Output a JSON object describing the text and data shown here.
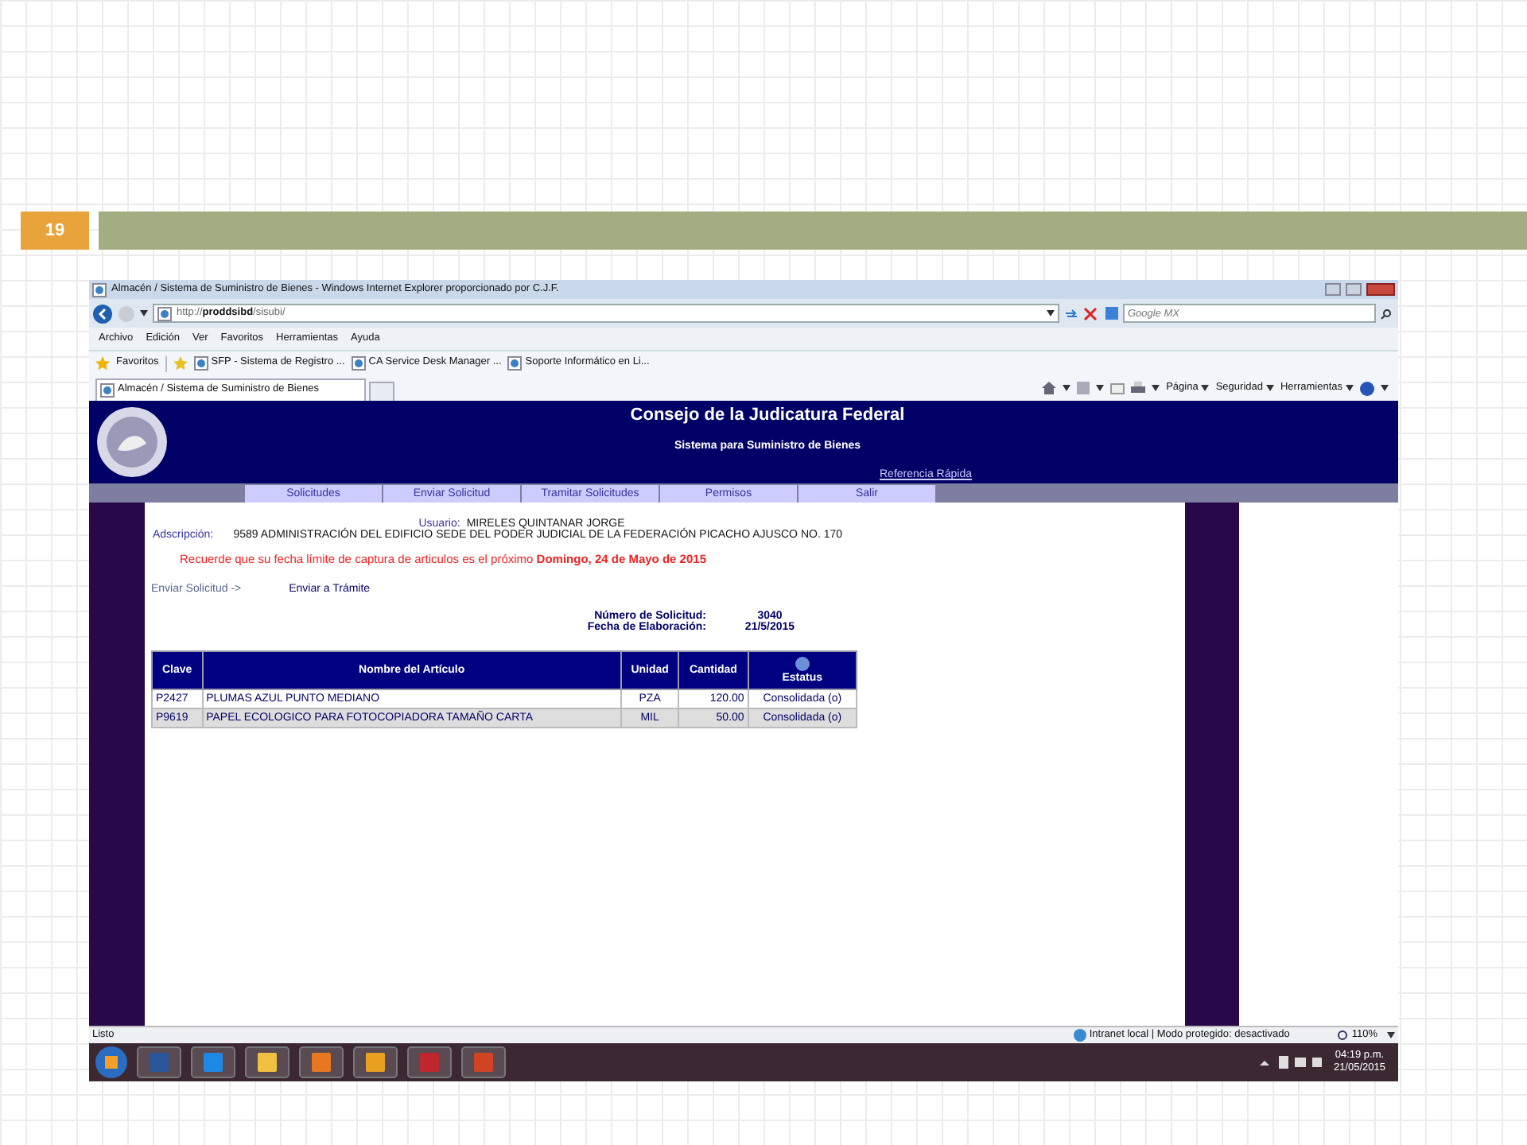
{
  "slide": {
    "number": "19"
  },
  "window": {
    "title": "Almacén / Sistema de Suministro de Bienes - Windows Internet Explorer proporcionado por C.J.F.",
    "url_prefix": "http://",
    "url_host": "proddsibd",
    "url_path": "/sisubi/",
    "search_placeholder": "Google MX"
  },
  "menu": [
    "Archivo",
    "Edición",
    "Ver",
    "Favoritos",
    "Herramientas",
    "Ayuda"
  ],
  "favorites": {
    "label": "Favoritos",
    "links": [
      "SFP - Sistema de Registro ...",
      "CA Service Desk Manager ...",
      "Soporte Informático en Li..."
    ]
  },
  "tab": {
    "title": "Almacén / Sistema de Suministro de Bienes"
  },
  "command_bar": [
    "Página",
    "Seguridad",
    "Herramientas"
  ],
  "header": {
    "title": "Consejo de la Judicatura Federal",
    "subtitle": "Sistema para Suministro de Bienes",
    "link": "Referencia Rápida"
  },
  "nav": [
    "Solicitudes",
    "Enviar Solicitud",
    "Tramitar Solicitudes",
    "Permisos",
    "Salir"
  ],
  "user": {
    "label": "Usuario:",
    "value": "MIRELES QUINTANAR JORGE"
  },
  "adscripcion": {
    "label": "Adscripción:",
    "value": "9589 ADMINISTRACIÓN DEL EDIFICIO SEDE DEL PODER JUDICIAL DE LA FEDERACIÓN PICACHO AJUSCO NO. 170"
  },
  "reminder": "Recuerde que su fecha límite de captura de articulos es el próximo **Domingo, 24 de Mayo de 2015**",
  "actions": [
    {
      "label": "Enviar Solicitud ->",
      "kind": "muted"
    },
    {
      "label": "Enviar a Trámite",
      "kind": "primary"
    }
  ],
  "request_info": [
    {
      "label": "Número de Solicitud:",
      "value": "3040"
    },
    {
      "label": "Fecha de Elaboración:",
      "value": "21/5/2015"
    }
  ],
  "table": {
    "columns": [
      "Clave",
      "Nombre del Artículo",
      "Unidad",
      "Cantidad",
      "Estatus"
    ],
    "rows": [
      [
        "P2427",
        "PLUMAS AZUL PUNTO MEDIANO",
        "PZA",
        "120.00",
        "Consolidada (o)"
      ],
      [
        "P9619",
        "PAPEL ECOLOGICO PARA FOTOCOPIADORA TAMAÑO CARTA",
        "MIL",
        "50.00",
        "Consolidada (o)"
      ]
    ]
  },
  "status_bar": {
    "text": "Listo",
    "zone": "Intranet local | Modo protegido: desactivado",
    "zoom": "110%"
  },
  "taskbar": {
    "time": "04:19 p.m.",
    "date": "21/05/2015"
  }
}
